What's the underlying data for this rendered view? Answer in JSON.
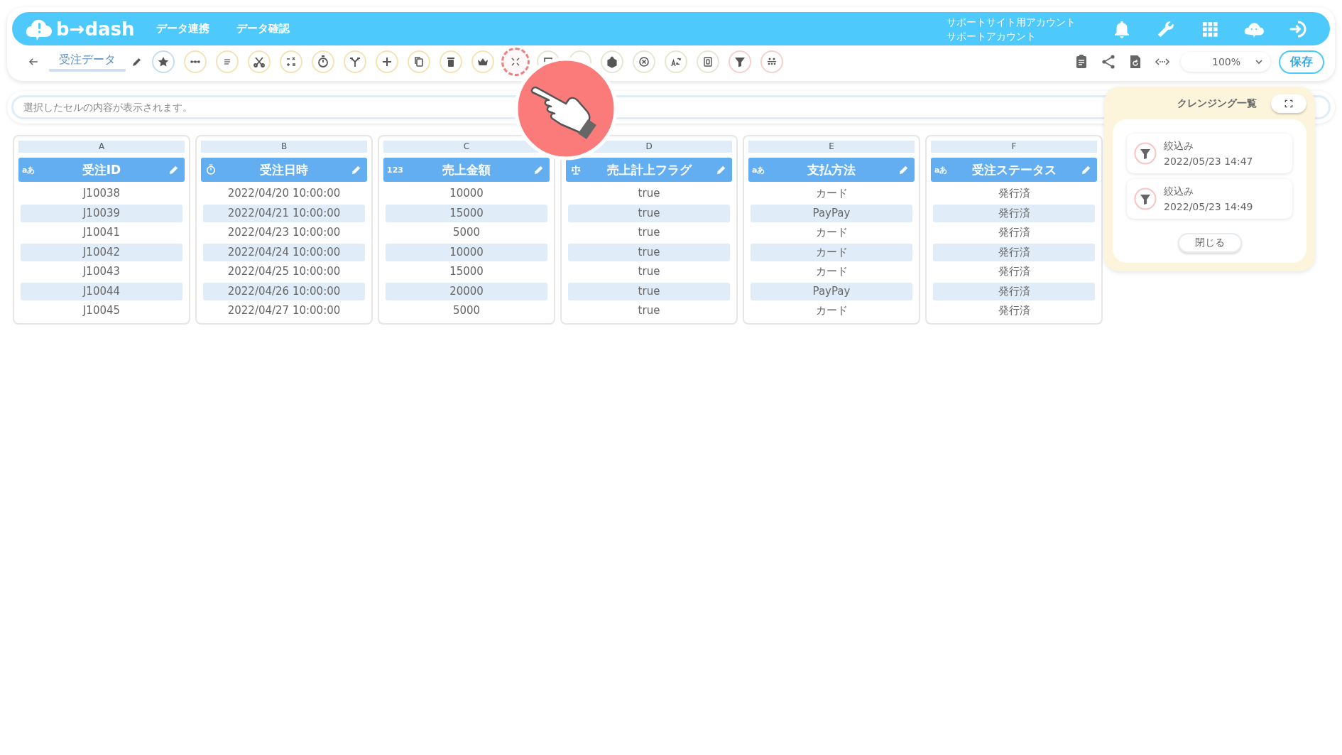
{
  "header": {
    "logo": "b→dash",
    "nav": [
      "データ連携",
      "データ確認"
    ],
    "account": [
      "サポートサイト用アカウント",
      "サポートアカウント"
    ]
  },
  "toolbar": {
    "sheet_name": "受注データ",
    "tools": [
      {
        "color": "#c9dcef",
        "selected": false
      },
      {
        "color": "#f5e3b5",
        "selected": false
      },
      {
        "color": "#f5e3b5",
        "selected": false
      },
      {
        "color": "#f5e3b5",
        "selected": false
      },
      {
        "color": "#f5e3b5",
        "selected": false
      },
      {
        "color": "#f5e3b5",
        "selected": false
      },
      {
        "color": "#f5e3b5",
        "selected": false
      },
      {
        "color": "#f5e3b5",
        "selected": false
      },
      {
        "color": "#f5e3b5",
        "selected": false
      },
      {
        "color": "#f5e3b5",
        "selected": false
      },
      {
        "color": "#f5e3b5",
        "selected": false
      },
      {
        "color": "#f07f7f",
        "selected": true
      },
      {
        "color": "#e2e8d2",
        "selected": false
      },
      {
        "color": "#e2e8d2",
        "selected": false
      },
      {
        "color": "#e2e8d2",
        "selected": false
      },
      {
        "color": "#e2e8d2",
        "selected": false
      },
      {
        "color": "#e2e8d2",
        "selected": false
      },
      {
        "color": "#e2e8d2",
        "selected": false
      },
      {
        "color": "#f7cfcf",
        "selected": false
      },
      {
        "color": "#f7cfcf",
        "selected": false
      }
    ],
    "zoom": "100%",
    "save": "保存"
  },
  "formula_bar": {
    "placeholder": "選択したセルの内容が表示されます。"
  },
  "columns": [
    {
      "letter": "A",
      "name": "受注ID",
      "kind": "text",
      "badge": "aあ",
      "cells": [
        "J10038",
        "J10039",
        "J10041",
        "J10042",
        "J10043",
        "J10044",
        "J10045"
      ]
    },
    {
      "letter": "B",
      "name": "受注日時",
      "kind": "datetime",
      "cells": [
        "2022/04/20 10:00:00",
        "2022/04/21 10:00:00",
        "2022/04/23 10:00:00",
        "2022/04/24 10:00:00",
        "2022/04/25 10:00:00",
        "2022/04/26 10:00:00",
        "2022/04/27 10:00:00"
      ]
    },
    {
      "letter": "C",
      "name": "売上金額",
      "kind": "number",
      "badge": "123",
      "cells": [
        "10000",
        "15000",
        "5000",
        "10000",
        "15000",
        "20000",
        "5000"
      ]
    },
    {
      "letter": "D",
      "name": "売上計上フラグ",
      "kind": "boolean",
      "cells": [
        "true",
        "true",
        "true",
        "true",
        "true",
        "true",
        "true"
      ]
    },
    {
      "letter": "E",
      "name": "支払方法",
      "kind": "text",
      "badge": "aあ",
      "cells": [
        "カード",
        "PayPay",
        "カード",
        "カード",
        "カード",
        "PayPay",
        "カード"
      ]
    },
    {
      "letter": "F",
      "name": "受注ステータス",
      "kind": "text",
      "badge": "aあ",
      "cells": [
        "発行済",
        "発行済",
        "発行済",
        "発行済",
        "発行済",
        "発行済",
        "発行済"
      ]
    }
  ],
  "cleansing_panel": {
    "title": "クレンジング一覧",
    "items": [
      {
        "label": "絞込み",
        "time": "2022/05/23 14:47"
      },
      {
        "label": "絞込み",
        "time": "2022/05/23 14:49"
      }
    ],
    "close": "閉じる"
  }
}
